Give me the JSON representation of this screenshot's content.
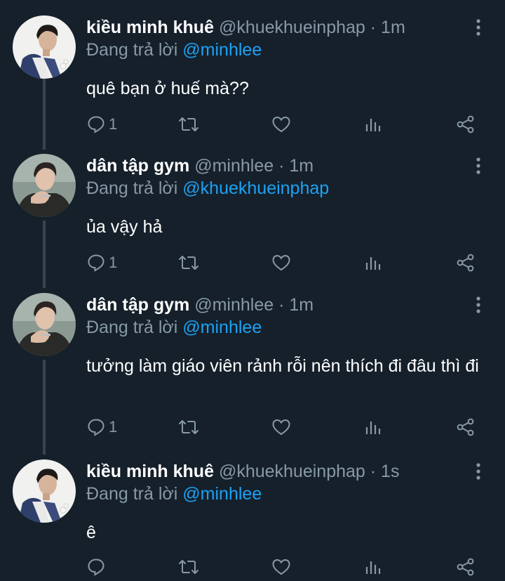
{
  "colors": {
    "background": "#15202b",
    "thread_line": "#38444d",
    "secondary_text": "#8899a6",
    "mention": "#1da1f2"
  },
  "tweets": [
    {
      "name": "kiều minh khuê",
      "handle": "@khuekhueinphap",
      "separator": "·",
      "time": "1m",
      "reply_prefix": "Đang trả lời",
      "reply_to": "@minhlee",
      "text": "quê bạn ở huế mà??",
      "reply_count": "1"
    },
    {
      "name": "dân tập gym",
      "handle": "@minhlee",
      "separator": "·",
      "time": "1m",
      "reply_prefix": "Đang trả lời",
      "reply_to": "@khuekhueinphap",
      "text": "ủa vậy hả",
      "reply_count": "1"
    },
    {
      "name": "dân tập gym",
      "handle": "@minhlee",
      "separator": "·",
      "time": "1m",
      "reply_prefix": "Đang trả lời",
      "reply_to": "@minhlee",
      "text": "tưởng làm giáo viên rảnh rỗi nên thích đi đâu thì đi",
      "reply_count": "1"
    },
    {
      "name": "kiều minh khuê",
      "handle": "@khuekhueinphap",
      "separator": "·",
      "time": "1s",
      "reply_prefix": "Đang trả lời",
      "reply_to": "@minhlee",
      "text": "ê",
      "reply_count": ""
    }
  ],
  "icons": {
    "more": "more-vertical-icon",
    "reply": "reply-icon",
    "retweet": "retweet-icon",
    "like": "heart-icon",
    "analytics": "analytics-icon",
    "share": "share-icon"
  }
}
